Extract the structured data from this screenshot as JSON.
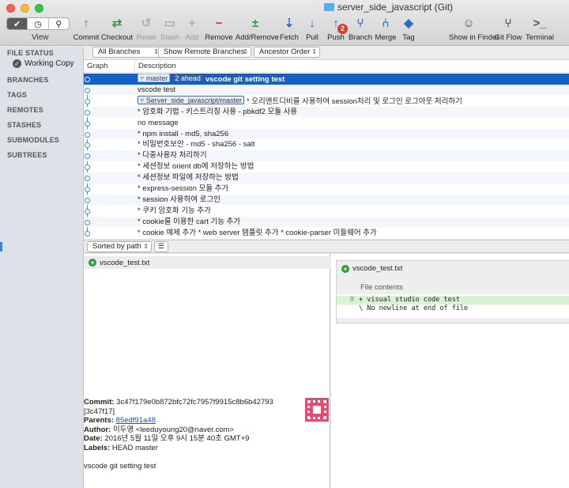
{
  "window": {
    "title": "server_side_javascript (Git)"
  },
  "toolbar": {
    "view_label": "View",
    "view_segments": [
      "✔",
      "◷",
      "⚲"
    ],
    "buttons": [
      {
        "label": "Commit",
        "icon": "commit-icon",
        "color": "#2f9a3b",
        "glyph": "↑",
        "enabled": true
      },
      {
        "label": "Checkout",
        "icon": "checkout-icon",
        "color": "#2f9a3b",
        "glyph": "⇄",
        "enabled": true
      },
      {
        "label": "Reset",
        "icon": "reset-icon",
        "color": "#777777",
        "glyph": "↺",
        "enabled": false
      },
      {
        "label": "Stash",
        "icon": "stash-icon",
        "color": "#777777",
        "glyph": "▭",
        "enabled": false
      },
      {
        "label": "Add",
        "icon": "add-icon",
        "color": "#2f9a3b",
        "glyph": "+",
        "enabled": false
      },
      {
        "label": "Remove",
        "icon": "remove-icon",
        "color": "#d9352b",
        "glyph": "−",
        "enabled": true
      },
      {
        "label": "Add/Remove",
        "icon": "add-remove-icon",
        "color": "#2f9a3b",
        "glyph": "±",
        "enabled": true
      },
      {
        "label": "Fetch",
        "icon": "fetch-icon",
        "color": "#2f6bc1",
        "glyph": "⇣",
        "enabled": true
      },
      {
        "label": "Pull",
        "icon": "pull-icon",
        "color": "#2f6bc1",
        "glyph": "↓",
        "enabled": true
      },
      {
        "label": "Push",
        "icon": "push-icon",
        "color": "#2f6bc1",
        "glyph": "↑",
        "enabled": true,
        "badge": "2"
      },
      {
        "label": "Branch",
        "icon": "branch-icon",
        "color": "#2f6bc1",
        "glyph": "⑂",
        "enabled": true
      },
      {
        "label": "Merge",
        "icon": "merge-icon",
        "color": "#2f6bc1",
        "glyph": "⑃",
        "enabled": true
      },
      {
        "label": "Tag",
        "icon": "tag-icon",
        "color": "#2f6bc1",
        "glyph": "◆",
        "enabled": true
      },
      {
        "label": "Show in Finder",
        "icon": "finder-icon",
        "color": "#555555",
        "glyph": "☺",
        "enabled": true
      },
      {
        "label": "Git Flow",
        "icon": "git-flow-icon",
        "color": "#555555",
        "glyph": "⑂",
        "enabled": true
      },
      {
        "label": "Terminal",
        "icon": "terminal-icon",
        "color": "#555555",
        "glyph": ">_",
        "enabled": true
      }
    ]
  },
  "sidebar": {
    "file_status": "FILE STATUS",
    "working_copy": "Working Copy",
    "sections": [
      "BRANCHES",
      "TAGS",
      "REMOTES",
      "STASHES",
      "SUBMODULES",
      "SUBTREES"
    ]
  },
  "filters": {
    "branches": "All Branches",
    "remote_branches": "Show Remote Branches",
    "order": "Ancestor Order"
  },
  "log": {
    "columns": {
      "graph": "Graph",
      "description": "Description"
    },
    "rows": [
      {
        "master_tag": "master",
        "ahead_tag": "2 ahead",
        "message": "vscode git setting test"
      },
      {
        "message": "vscode test"
      },
      {
        "remote_tag": "Server_side_javascript/master",
        "message": "* 오리엔트디비를 사용하여 session처리 및 로그인 로그아웃 처리하기"
      },
      {
        "message": "* 암호화 기법 - 키스트리칭 사용 -  pbkdf2 모듈 사용"
      },
      {
        "message": "no message"
      },
      {
        "message": "* npm install - md5, sha256"
      },
      {
        "message": "* 비밀번호보안 - md5 - sha256 - salt"
      },
      {
        "message": "* 다중사용자 처리하기"
      },
      {
        "message": "* 세션정보 orient db에 저장하는 방법"
      },
      {
        "message": "* 세션정보 파일에 저장하는 방법"
      },
      {
        "message": "* express-session 모듈 추가"
      },
      {
        "message": "* session 사용하여 로그인"
      },
      {
        "message": "* 쿠키 암호화 기능 추가"
      },
      {
        "message": "* cookie를 이용한 cart 기능 추가"
      },
      {
        "message": "* cookie 예제 추가 * web server 템플릿 추가 * cookie-parser 미들웨어 추가"
      }
    ]
  },
  "files": {
    "sort_label": "Sorted by path",
    "list_button": "☰",
    "items": [
      "vscode_test.txt"
    ]
  },
  "commit": {
    "commit_label": "Commit:",
    "hash": "3c47f179e0b872bfc72fc7957f9915c8b6b42793",
    "short_hash": "[3c47f17]",
    "parents_label": "Parents:",
    "parent": "85edf91a48",
    "author_label": "Author:",
    "author": "이두영 <leeduyoung20@naver.com>",
    "date_label": "Date:",
    "date": "2016년 5월 11일 오후 9시 15분 40초 GMT+9",
    "labels_label": "Labels:",
    "labels": "HEAD master",
    "message": "vscode git setting test"
  },
  "diff": {
    "file": "vscode_test.txt",
    "contents_label": "File contents",
    "lines": [
      {
        "num": "0",
        "text": "+ visual studio code test"
      },
      {
        "num": "",
        "text": "\\  No newline at end of file"
      }
    ]
  }
}
